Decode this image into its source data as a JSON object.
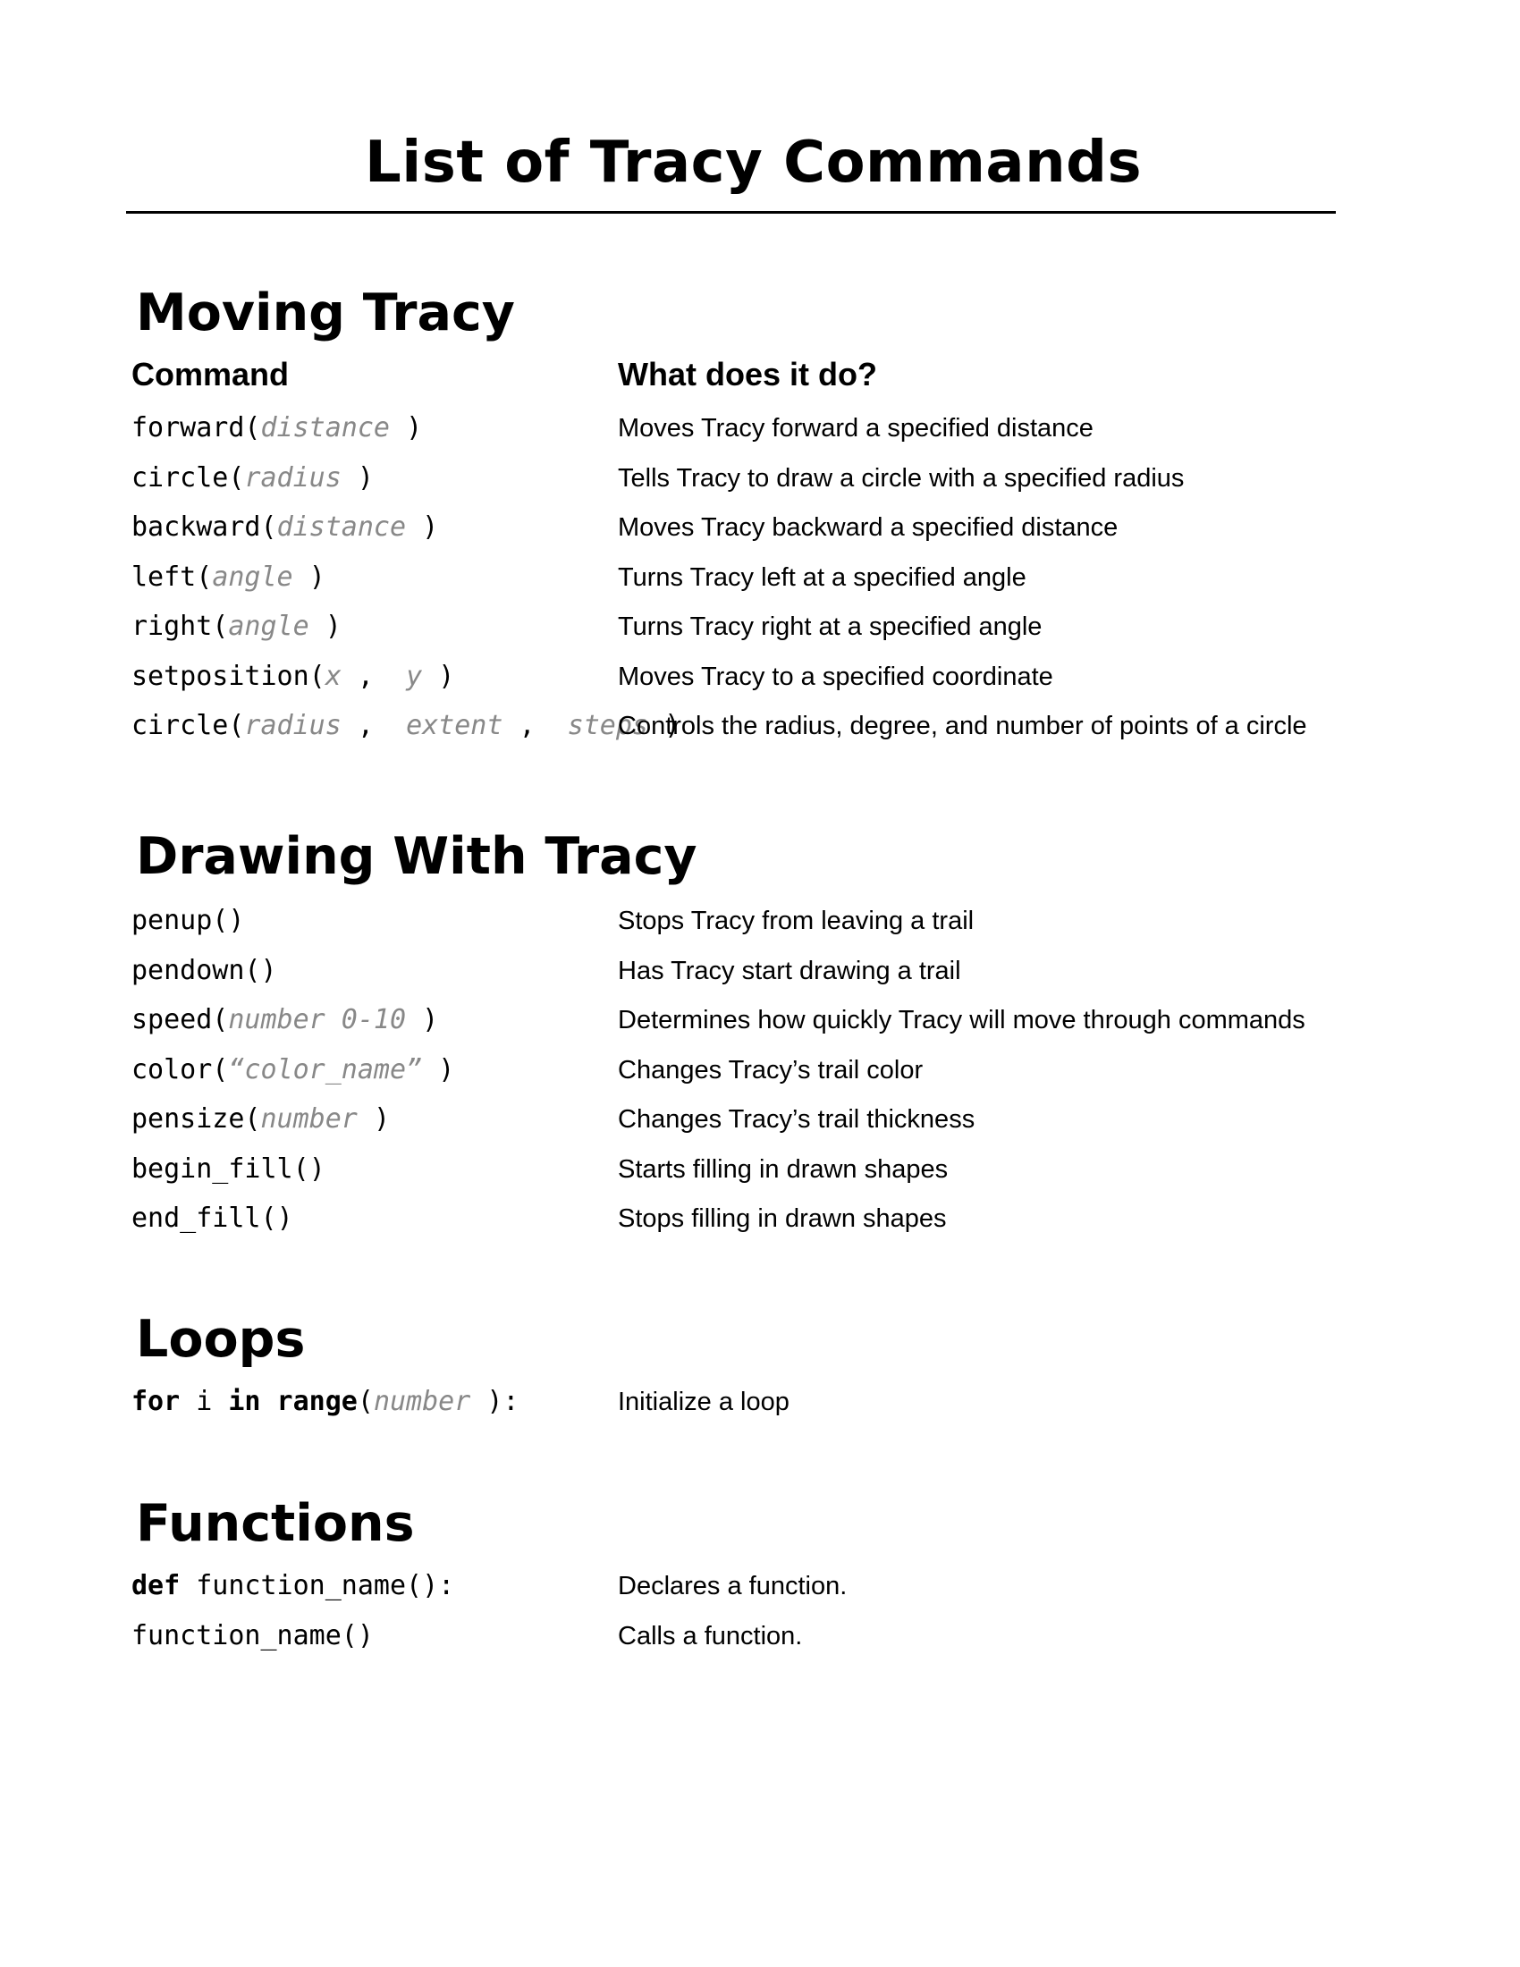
{
  "title": "List of Tracy Commands",
  "sections": {
    "moving": {
      "heading": "Moving Tracy",
      "col_command": "Command",
      "col_description": "What does it do?",
      "rows": [
        {
          "fn": "forward(",
          "args": [
            "distance"
          ],
          "close": ")",
          "desc": "Moves Tracy forward a specified distance"
        },
        {
          "fn": "circle(",
          "args": [
            "radius"
          ],
          "close": ")",
          "desc": "Tells Tracy to draw a circle with a specified radius"
        },
        {
          "fn": "backward(",
          "args": [
            "distance"
          ],
          "close": ")",
          "desc": "Moves Tracy backward a specified distance"
        },
        {
          "fn": "left(",
          "args": [
            "angle"
          ],
          "close": ")",
          "desc": "Turns Tracy left at a specified angle"
        },
        {
          "fn": "right(",
          "args": [
            "angle"
          ],
          "close": ")",
          "desc": "Turns Tracy right at a specified angle"
        },
        {
          "fn": "setposition(",
          "args": [
            "x",
            "y"
          ],
          "close": ")",
          "desc": "Moves Tracy to a specified coordinate"
        },
        {
          "fn": "circle(",
          "args": [
            "radius",
            "extent",
            "steps"
          ],
          "close": ")",
          "desc": "Controls the radius, degree, and number of points of a circle"
        }
      ]
    },
    "drawing": {
      "heading": "Drawing With Tracy",
      "rows": [
        {
          "fn": "penup(",
          "args": [],
          "close": ")",
          "desc": "Stops Tracy from leaving a trail"
        },
        {
          "fn": "pendown(",
          "args": [],
          "close": ")",
          "desc": "Has Tracy start drawing a trail"
        },
        {
          "fn": "speed(",
          "args": [
            "number 0-10"
          ],
          "close": ")",
          "desc": "Determines how quickly Tracy will move through commands"
        },
        {
          "fn": "color(",
          "args": [
            "“color_name”"
          ],
          "close": ")",
          "desc": "Changes Tracy’s trail color"
        },
        {
          "fn": "pensize(",
          "args": [
            "number"
          ],
          "close": ")",
          "desc": "Changes Tracy’s trail thickness"
        },
        {
          "fn": "begin_fill(",
          "args": [],
          "close": ")",
          "desc": "Starts filling in drawn shapes"
        },
        {
          "fn": "end_fill(",
          "args": [],
          "close": ")",
          "desc": "Stops filling in drawn shapes"
        }
      ]
    },
    "loops": {
      "heading": "Loops",
      "rows": [
        {
          "kw1": "for",
          "plain1": " i ",
          "kw2": "in",
          "kw3": " range",
          "fn": "(",
          "args": [
            "number"
          ],
          "close": "):",
          "desc": "Initialize a loop"
        }
      ]
    },
    "functions": {
      "heading": "Functions",
      "rows": [
        {
          "kw1": "def",
          "fn": " function_name(",
          "args": [],
          "close": "):",
          "desc": "Declares a function."
        },
        {
          "fn": "function_name(",
          "args": [],
          "close": ")",
          "desc": "Calls a function."
        }
      ]
    }
  },
  "colors": {
    "text": "#000000",
    "argument": "#888888",
    "rule": "#000000"
  }
}
